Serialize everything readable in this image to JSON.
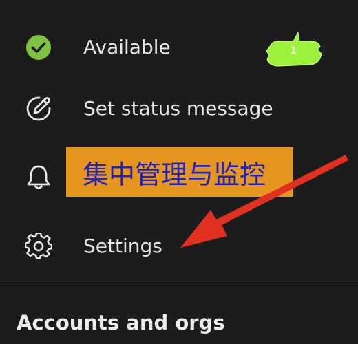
{
  "menu": {
    "available": {
      "label": "Available",
      "icon": "check-circle-icon",
      "icon_color": "#7ec242"
    },
    "status": {
      "label": "Set status message",
      "icon": "pencil-circle-icon"
    },
    "notifications": {
      "label": "",
      "icon": "bell-icon"
    },
    "settings": {
      "label": "Settings",
      "icon": "gear-icon"
    }
  },
  "accounts": {
    "heading": "Accounts and orgs"
  },
  "overlay": {
    "callout_text": "集中管理与监控",
    "callout_bg": "#e6951f",
    "callout_text_color": "#2323b4",
    "badge_count": "1",
    "badge_color": "#9cf23a",
    "arrow_color": "#e03020"
  }
}
